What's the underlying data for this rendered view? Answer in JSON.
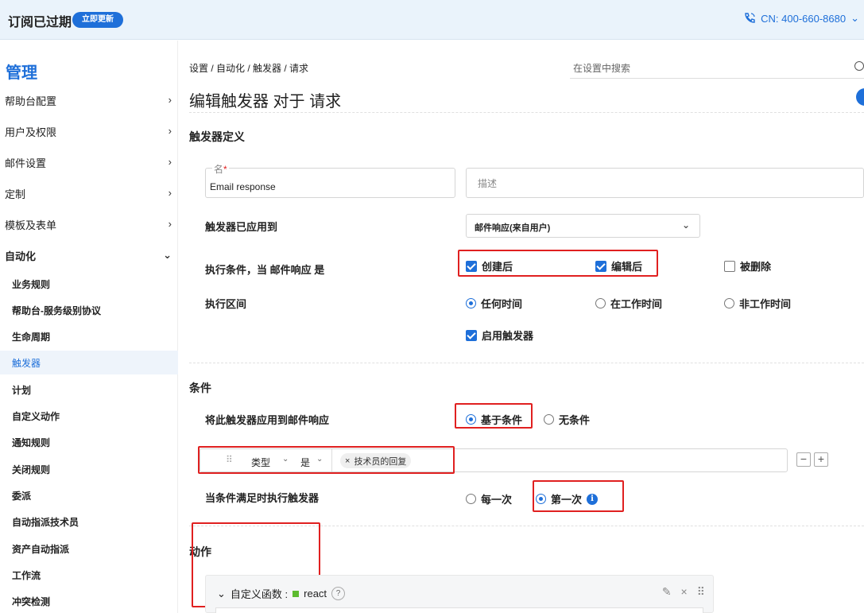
{
  "topbar": {
    "title": "订阅已过期",
    "renew_label": "立即更新",
    "phone": "CN: 400-660-8680",
    "phone_chevron": "⌄"
  },
  "sidebar": {
    "heading": "管理",
    "items": [
      {
        "label": "帮助台配置",
        "chevron": "›"
      },
      {
        "label": "用户及权限",
        "chevron": "›"
      },
      {
        "label": "邮件设置",
        "chevron": "›"
      },
      {
        "label": "定制",
        "chevron": "›"
      },
      {
        "label": "模板及表单",
        "chevron": "›"
      },
      {
        "label": "自动化",
        "chevron": "⌄"
      }
    ],
    "sub_items": [
      {
        "label": "业务规则"
      },
      {
        "label": "帮助台-服务级别协议"
      },
      {
        "label": "生命周期"
      },
      {
        "label": "触发器",
        "active": true
      },
      {
        "label": "计划"
      },
      {
        "label": "自定义动作"
      },
      {
        "label": "通知规则"
      },
      {
        "label": "关闭规则"
      },
      {
        "label": "委派"
      },
      {
        "label": "自动指派技术员"
      },
      {
        "label": "资产自动指派"
      },
      {
        "label": "工作流"
      },
      {
        "label": "冲突检测"
      }
    ]
  },
  "main": {
    "breadcrumb": "设置 / 自动化 / 触发器 / 请求",
    "search_placeholder": "在设置中搜索",
    "page_title": "编辑触发器 对于 请求",
    "definition_title": "触发器定义",
    "name_label": "名",
    "name_required": "*",
    "name_value": "Email response",
    "description_placeholder": "描述",
    "applied_to_label": "触发器已应用到",
    "applied_to_value": "邮件响应(来自用户)",
    "exec_condition_label": "执行条件，当 邮件响应 是",
    "exec_options": [
      {
        "label": "创建后",
        "checked": true
      },
      {
        "label": "编辑后",
        "checked": true
      },
      {
        "label": "被删除",
        "checked": false
      }
    ],
    "interval_label": "执行区间",
    "interval_options": [
      {
        "label": "任何时间",
        "selected": true
      },
      {
        "label": "在工作时间",
        "selected": false
      },
      {
        "label": "非工作时间",
        "selected": false
      }
    ],
    "enable_label": "启用触发器",
    "enable_checked": true,
    "conditions_title": "条件",
    "apply_label": "将此触发器应用到邮件响应",
    "apply_options": [
      {
        "label": "基于条件",
        "selected": true
      },
      {
        "label": "无条件",
        "selected": false
      }
    ],
    "cond_field": "类型",
    "cond_operator": "是",
    "cond_value": "技术员的回复",
    "minus_label": "−",
    "plus_label": "+",
    "when_label": "当条件满足时执行触发器",
    "when_options": [
      {
        "label": "每一次",
        "selected": false
      },
      {
        "label": "第一次",
        "selected": true
      }
    ],
    "info_icon": "i",
    "actions_title": "动作",
    "action_name": "自定义函数 :",
    "action_value": "react",
    "action_help": "?"
  },
  "colors": {
    "accent": "#1e6fd9",
    "highlight": "#e02020",
    "topbar_bg": "#eaf3fb"
  }
}
